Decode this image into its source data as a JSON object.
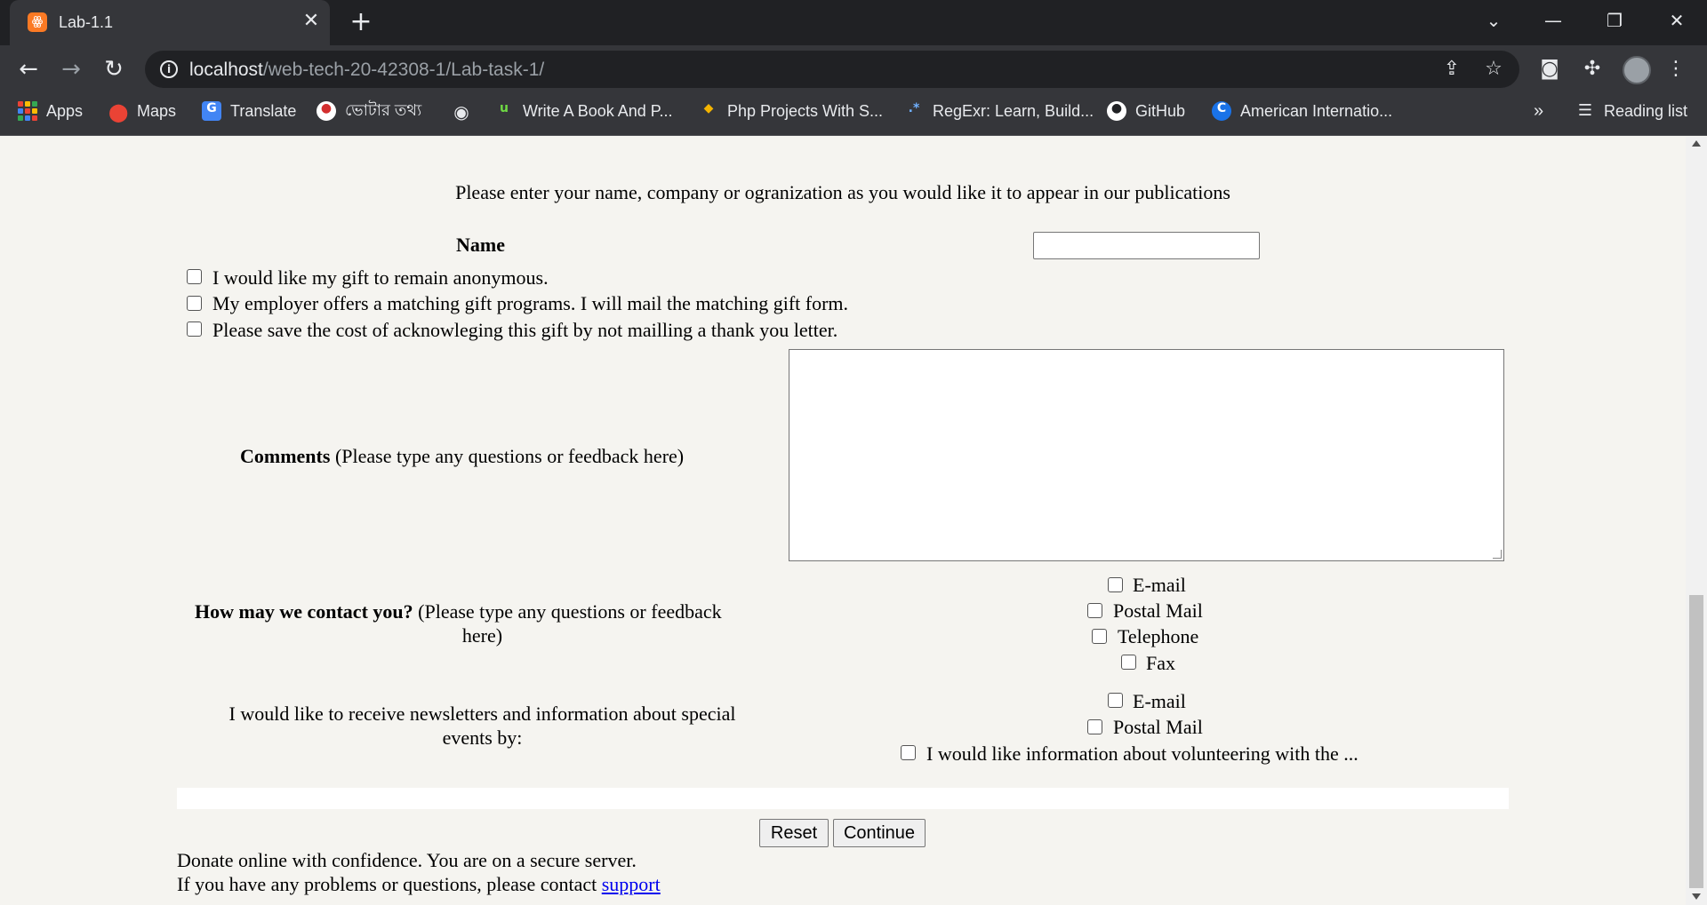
{
  "browser": {
    "tab_title": "Lab-1.1",
    "tab_favicon": "xampp-icon",
    "url_host": "localhost",
    "url_path": "/web-tech-20-42308-1/Lab-task-1/",
    "bookmarks": [
      {
        "label": "Apps",
        "icon": "apps-grid-icon"
      },
      {
        "label": "Maps",
        "icon": "maps-pin-icon"
      },
      {
        "label": "Translate",
        "icon": "translate-icon"
      },
      {
        "label": "ভোটার তথ্য",
        "icon": "bd-seal-icon"
      },
      {
        "label": "",
        "icon": "globe-icon"
      },
      {
        "label": "Write A Book And P...",
        "icon": "upwork-icon"
      },
      {
        "label": "Php Projects With S...",
        "icon": "php-projects-icon"
      },
      {
        "label": "RegExr: Learn, Build...",
        "icon": "regexr-icon"
      },
      {
        "label": "GitHub",
        "icon": "github-icon"
      },
      {
        "label": "American Internatio...",
        "icon": "aiub-icon"
      }
    ],
    "bookmarks_overflow": "»",
    "reading_list": "Reading list",
    "colors": {
      "chrome_bg": "#202124",
      "toolbar_bg": "#35363a",
      "page_bg": "#f5f4f0",
      "link": "#0000ee"
    }
  },
  "form": {
    "intro": "Please enter your name, company or ogranization as you would like it to appear in our publications",
    "name_label": "Name",
    "name_value": "",
    "options": [
      "I would like my gift to remain anonymous.",
      "My employer offers a matching gift programs. I will mail the matching gift form.",
      "Please save the cost of acknowleging this gift by not mailling a thank you letter."
    ],
    "comments_label": "Comments",
    "comments_hint": " (Please type any questions or feedback here)",
    "comments_value": "",
    "contact_label": "How may we contact you?",
    "contact_hint_line1": " (Please type any questions or feedback",
    "contact_hint_line2": "here)",
    "contact_options": [
      "E-mail",
      "Postal Mail",
      "Telephone",
      "Fax"
    ],
    "newsletter_line1": "I would like to receive newsletters and information about special",
    "newsletter_line2": "events by:",
    "newsletter_options": [
      "E-mail",
      "Postal Mail",
      "I would like information about volunteering with the ..."
    ],
    "reset_label": "Reset",
    "continue_label": "Continue",
    "footer_line1": "Donate online with confidence. You are on a secure server.",
    "footer_line2": "If you have any problems or questions, please contact ",
    "support_link": "support"
  }
}
